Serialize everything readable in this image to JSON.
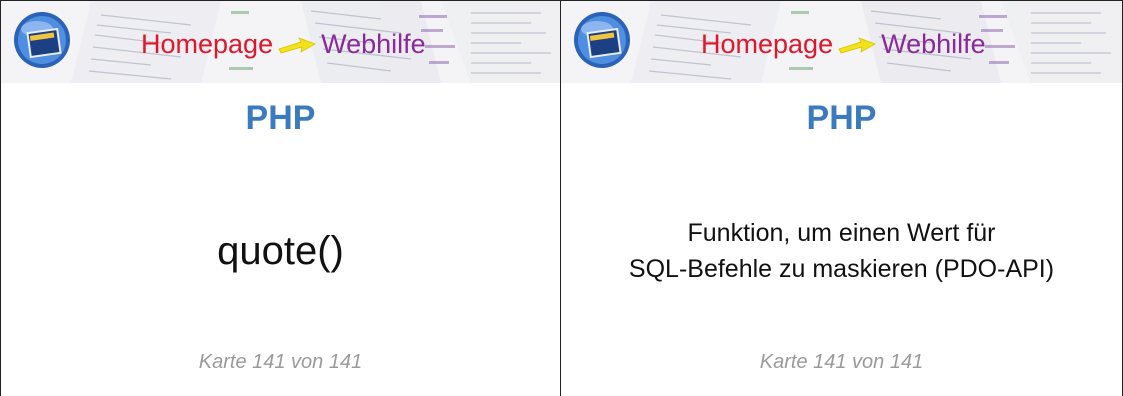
{
  "brand": {
    "word1": "Homepage",
    "word2": "Webhilfe"
  },
  "cards": [
    {
      "subject": "PHP",
      "content": "quote()",
      "counter": "Karte 141 von 141"
    },
    {
      "subject": "PHP",
      "content_line1": "Funktion, um einen Wert für",
      "content_line2": "SQL-Befehle zu maskieren (PDO-API)",
      "counter": "Karte 141 von 141"
    }
  ],
  "colors": {
    "subject": "#3a7bbf",
    "brand_red": "#e0162a",
    "brand_purple": "#8a2a9a",
    "footer": "#9a9a9a"
  }
}
